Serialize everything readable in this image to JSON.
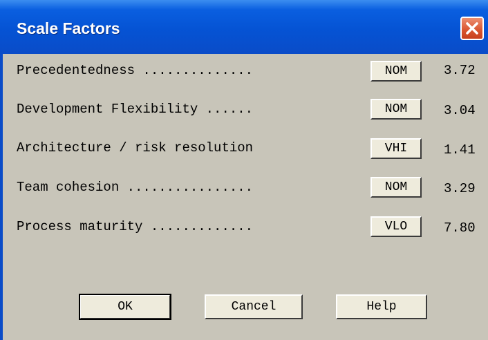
{
  "window": {
    "title": "Scale Factors",
    "close_icon": "close-icon"
  },
  "rows": [
    {
      "label": "Precedentedness ..............",
      "level": "NOM",
      "value": "3.72"
    },
    {
      "label": "Development Flexibility ......",
      "level": "NOM",
      "value": "3.04"
    },
    {
      "label": "Architecture / risk resolution",
      "level": "VHI",
      "value": "1.41"
    },
    {
      "label": "Team cohesion ................",
      "level": "NOM",
      "value": "3.29"
    },
    {
      "label": "Process maturity .............",
      "level": "VLO",
      "value": "7.80"
    }
  ],
  "buttons": {
    "ok": "OK",
    "cancel": "Cancel",
    "help": "Help"
  }
}
